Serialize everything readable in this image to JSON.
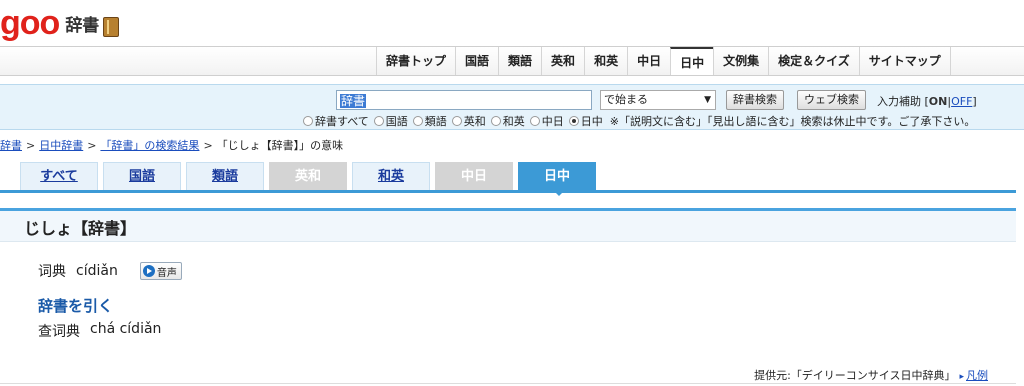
{
  "header": {
    "logo_goo": "goo",
    "logo_jisho": "辞書",
    "book_icon": "book-icon"
  },
  "topnav": {
    "items": [
      {
        "label": "辞書トップ"
      },
      {
        "label": "国語"
      },
      {
        "label": "類語"
      },
      {
        "label": "英和"
      },
      {
        "label": "和英"
      },
      {
        "label": "中日"
      },
      {
        "label": "日中",
        "active": true
      },
      {
        "label": "文例集"
      },
      {
        "label": "検定＆クイズ"
      },
      {
        "label": "サイトマップ"
      }
    ]
  },
  "search": {
    "value": "辞書",
    "mode": "で始まる",
    "search_button": "辞書検索",
    "web_button": "ウェブ検索",
    "assist_label": "入力補助 [",
    "assist_on": "ON",
    "assist_sep": "|",
    "assist_off": "OFF",
    "assist_close": "]",
    "radios": [
      {
        "label": "辞書すべて",
        "checked": false
      },
      {
        "label": "国語",
        "checked": false
      },
      {
        "label": "類語",
        "checked": false
      },
      {
        "label": "英和",
        "checked": false
      },
      {
        "label": "和英",
        "checked": false
      },
      {
        "label": "中日",
        "checked": false
      },
      {
        "label": "日中",
        "checked": true
      }
    ],
    "notice": "※「説明文に含む」「見出し語に含む」検索は休止中です。ご了承下さい。"
  },
  "breadcrumb": {
    "items": [
      "辞書",
      "日中辞書",
      "「辞書」の検索結果"
    ],
    "current": "「じしょ【辞書】」の意味"
  },
  "tabs": [
    {
      "label": "すべて",
      "state": "link"
    },
    {
      "label": "国語",
      "state": "link"
    },
    {
      "label": "類語",
      "state": "link"
    },
    {
      "label": "英和",
      "state": "disabled"
    },
    {
      "label": "和英",
      "state": "link"
    },
    {
      "label": "中日",
      "state": "disabled"
    },
    {
      "label": "日中",
      "state": "current"
    }
  ],
  "entry": {
    "title": "じしょ【辞書】",
    "word": "词典",
    "pinyin": "cídiǎn",
    "audio_label": "音声",
    "idiom": "辞書を引く",
    "idiom_word": "查词典",
    "idiom_pinyin": "chá cídiǎn"
  },
  "source": {
    "text": "提供元:「デイリーコンサイス日中辞典」",
    "link": "凡例"
  },
  "colors": {
    "accent": "#3c9ad6",
    "brand": "#e0221b",
    "link": "#1a4dbd"
  }
}
